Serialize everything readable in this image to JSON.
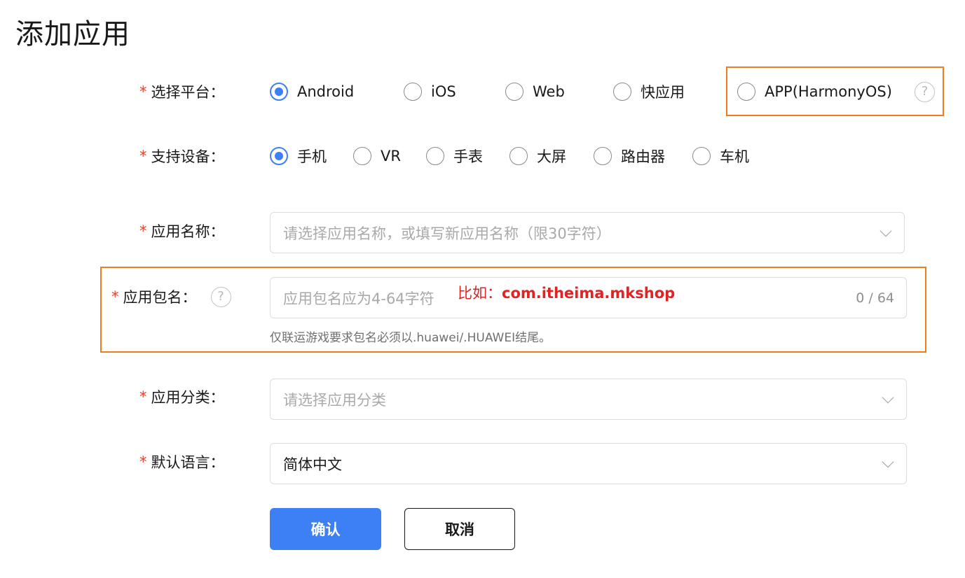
{
  "page_title": "添加应用",
  "required_mark": "*",
  "platform": {
    "label": "选择平台：",
    "options": [
      "Android",
      "iOS",
      "Web",
      "快应用",
      "APP(HarmonyOS)"
    ],
    "selected": "Android",
    "help_glyph": "?"
  },
  "device": {
    "label": "支持设备：",
    "options": [
      "手机",
      "VR",
      "手表",
      "大屏",
      "路由器",
      "车机"
    ],
    "selected": "手机"
  },
  "app_name": {
    "label": "应用名称：",
    "placeholder": "请选择应用名称，或填写新应用名称（限30字符）"
  },
  "package_name": {
    "label": "应用包名：",
    "help_glyph": "?",
    "placeholder": "应用包名应为4-64字符",
    "counter": "0 / 64",
    "annotation_prefix": "比如：",
    "annotation_value": "com.itheima.mkshop",
    "hint": "仅联运游戏要求包名必须以.huawei/.HUAWEI结尾。"
  },
  "category": {
    "label": "应用分类：",
    "placeholder": "请选择应用分类"
  },
  "language": {
    "label": "默认语言：",
    "value": "简体中文"
  },
  "buttons": {
    "confirm": "确认",
    "cancel": "取消"
  },
  "colors": {
    "accent": "#3d7ff5",
    "required": "#e84026",
    "highlight_box": "#f07c1c",
    "annotation": "#e02323"
  }
}
